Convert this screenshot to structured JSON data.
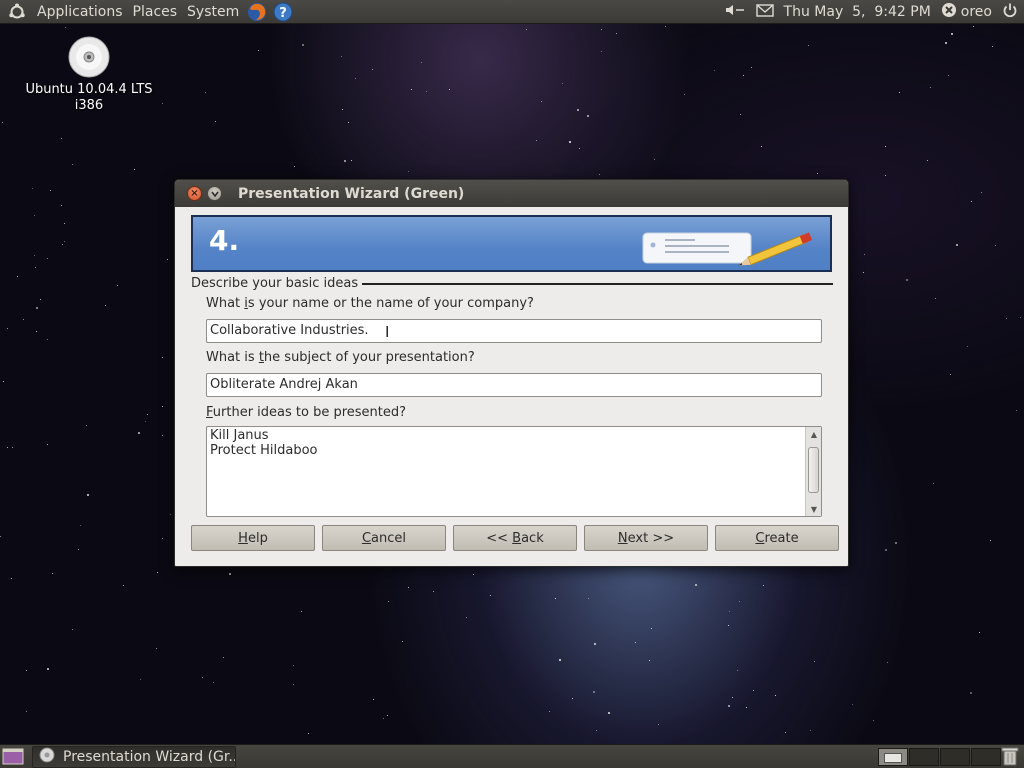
{
  "top_panel": {
    "menus": [
      "Applications",
      "Places",
      "System"
    ],
    "clock": "Thu May  5,  9:42 PM",
    "user": "oreo"
  },
  "desktop": {
    "icon_line1": "Ubuntu 10.04.4 LTS",
    "icon_line2": "i386"
  },
  "window": {
    "title": "Presentation Wizard (Green)",
    "step": "4.",
    "section": "Describe your basic ideas",
    "q1_label_pre": "What ",
    "q1_label_u": "i",
    "q1_label_post": "s your name or the name of your company?",
    "q1_value": "Collaborative Industries.",
    "q2_label_pre": "What is ",
    "q2_label_u": "t",
    "q2_label_post": "he subject of your presentation?",
    "q2_value": "Obliterate Andrej Akan",
    "q3_label_u": "F",
    "q3_label_post": "urther ideas to be presented?",
    "q3_lines": [
      "Kill Janus",
      "Protect Hildaboo"
    ],
    "buttons": {
      "help_u": "H",
      "help_rest": "elp",
      "cancel_u": "C",
      "cancel_rest": "ancel",
      "back_pre": "<< ",
      "back_u": "B",
      "back_rest": "ack",
      "next_u": "N",
      "next_rest": "ext >>",
      "create_u": "C",
      "create_rest": "reate"
    }
  },
  "taskbar": {
    "task_label": "Presentation Wizard (Gr..."
  },
  "colors": {
    "banner_blue": "#5483c7",
    "close_orange": "#d3532a",
    "dialog_bg": "#edeceb"
  }
}
